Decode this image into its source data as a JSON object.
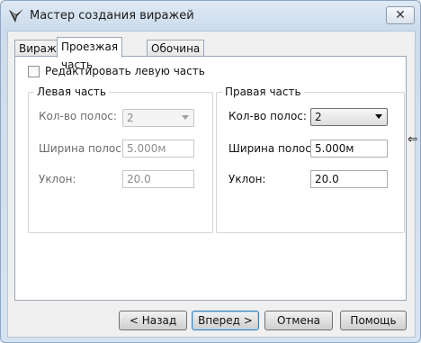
{
  "window": {
    "title": "Мастер создания виражей",
    "close_glyph": "✕"
  },
  "tabs": [
    {
      "label": "Вираж"
    },
    {
      "label": "Проезжая часть"
    },
    {
      "label": "Обочина"
    }
  ],
  "edit_left": {
    "label": "Редактировать левую часть"
  },
  "left": {
    "title": "Левая часть",
    "lanes_label": "Кол-во полос:",
    "lanes_value": "2",
    "width_label": "Ширина полосы:",
    "width_value": "5.000м",
    "slope_label": "Уклон:",
    "slope_value": "20.0"
  },
  "right": {
    "title": "Правая часть",
    "lanes_label": "Кол-во полос:",
    "lanes_value": "2",
    "width_label": "Ширина полосы:",
    "width_value": "5.000м",
    "slope_label": "Уклон:",
    "slope_value": "20.0"
  },
  "buttons": {
    "back": "< Назад",
    "next": "Вперед >",
    "cancel": "Отмена",
    "help": "Помощь"
  },
  "resize_glyph": "⇐"
}
